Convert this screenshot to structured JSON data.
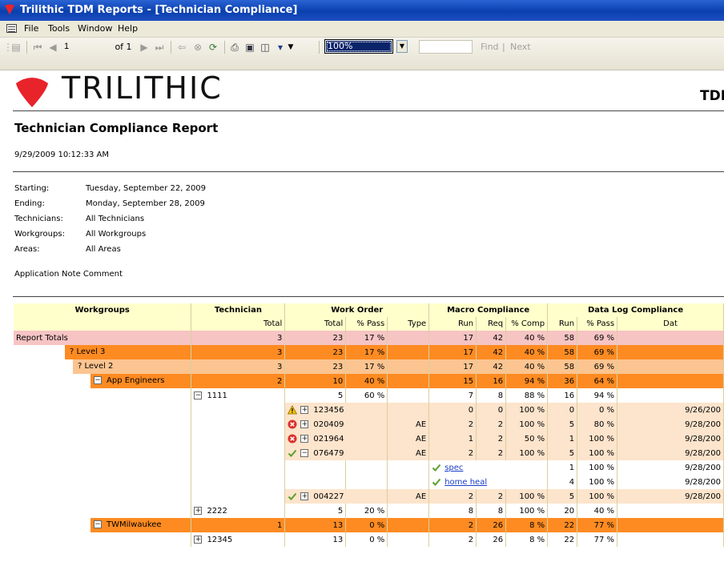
{
  "window": {
    "title": "Trilithic TDM Reports - [Technician Compliance]"
  },
  "menu": [
    "File",
    "Tools",
    "Window",
    "Help"
  ],
  "toolbar": {
    "page_input": "1",
    "page_of": "of 1",
    "zoom": "100%",
    "find_placeholder": "",
    "find_label": "Find",
    "find_sep": "|",
    "next_label": "Next"
  },
  "header": {
    "brand": "TRILITHIC",
    "product": "TDM"
  },
  "report": {
    "title": "Technician Compliance Report",
    "generated": "9/29/2009 10:12:33 AM",
    "params": [
      {
        "label": "Starting:",
        "value": "Tuesday, September 22, 2009"
      },
      {
        "label": "Ending:",
        "value": "Monday, September 28, 2009"
      },
      {
        "label": "Technicians:",
        "value": "All Technicians"
      },
      {
        "label": "Workgroups:",
        "value": "All Workgroups"
      },
      {
        "label": "Areas:",
        "value": "All Areas"
      }
    ],
    "comment": "Application Note Comment"
  },
  "table": {
    "group_headers": [
      "Workgroups",
      "Technician",
      "Work Order",
      "Macro Compliance",
      "Data Log Compliance"
    ],
    "sub_headers": [
      "Total",
      "Total",
      "% Pass",
      "Type",
      "Run",
      "Req",
      "% Comp",
      "Run",
      "% Pass",
      "Dat"
    ],
    "rows": [
      {
        "label": "Report Totals",
        "tech_total": "3",
        "wo_total": "23",
        "wo_pass": "17 %",
        "type": "",
        "m_run": "17",
        "m_req": "42",
        "m_comp": "40 %",
        "d_run": "58",
        "d_pass": "69 %",
        "date": ""
      },
      {
        "label": "? Level 3",
        "tech_total": "3",
        "wo_total": "23",
        "wo_pass": "17 %",
        "type": "",
        "m_run": "17",
        "m_req": "42",
        "m_comp": "40 %",
        "d_run": "58",
        "d_pass": "69 %",
        "date": ""
      },
      {
        "label": "? Level 2",
        "tech_total": "3",
        "wo_total": "23",
        "wo_pass": "17 %",
        "type": "",
        "m_run": "17",
        "m_req": "42",
        "m_comp": "40 %",
        "d_run": "58",
        "d_pass": "69 %",
        "date": ""
      },
      {
        "label": "App Engineers",
        "tech_total": "2",
        "wo_total": "10",
        "wo_pass": "40 %",
        "type": "",
        "m_run": "15",
        "m_req": "16",
        "m_comp": "94 %",
        "d_run": "36",
        "d_pass": "64 %",
        "date": ""
      },
      {
        "label": "1111",
        "wo_total": "5",
        "wo_pass": "60 %",
        "m_run": "7",
        "m_req": "8",
        "m_comp": "88 %",
        "d_run": "16",
        "d_pass": "94 %",
        "date": ""
      },
      {
        "label": "123456",
        "type": "",
        "m_run": "0",
        "m_req": "0",
        "m_comp": "100 %",
        "d_run": "0",
        "d_pass": "0 %",
        "date": "9/26/200"
      },
      {
        "label": "020409",
        "type": "AE",
        "m_run": "2",
        "m_req": "2",
        "m_comp": "100 %",
        "d_run": "5",
        "d_pass": "80 %",
        "date": "9/28/200"
      },
      {
        "label": "021964",
        "type": "AE",
        "m_run": "1",
        "m_req": "2",
        "m_comp": "50 %",
        "d_run": "1",
        "d_pass": "100 %",
        "date": "9/28/200"
      },
      {
        "label": "076479",
        "type": "AE",
        "m_run": "2",
        "m_req": "2",
        "m_comp": "100 %",
        "d_run": "5",
        "d_pass": "100 %",
        "date": "9/28/200"
      },
      {
        "label": "spec",
        "d_run": "1",
        "d_pass": "100 %",
        "date": "9/28/200"
      },
      {
        "label": "home heal",
        "d_run": "4",
        "d_pass": "100 %",
        "date": "9/28/200"
      },
      {
        "label": "004227",
        "type": "AE",
        "m_run": "2",
        "m_req": "2",
        "m_comp": "100 %",
        "d_run": "5",
        "d_pass": "100 %",
        "date": "9/28/200"
      },
      {
        "label": "2222",
        "wo_total": "5",
        "wo_pass": "20 %",
        "m_run": "8",
        "m_req": "8",
        "m_comp": "100 %",
        "d_run": "20",
        "d_pass": "40 %",
        "date": ""
      },
      {
        "label": "TWMilwaukee",
        "tech_total": "1",
        "wo_total": "13",
        "wo_pass": "0 %",
        "type": "",
        "m_run": "2",
        "m_req": "26",
        "m_comp": "8 %",
        "d_run": "22",
        "d_pass": "77 %",
        "date": ""
      },
      {
        "label": "12345",
        "wo_total": "13",
        "wo_pass": "0 %",
        "m_run": "2",
        "m_req": "26",
        "m_comp": "8 %",
        "d_run": "22",
        "d_pass": "77 %",
        "date": ""
      }
    ]
  },
  "colors": {
    "pink": "#f7c4c4",
    "orange": "#fd8b22",
    "peach": "#fcc490",
    "light_peach": "#fde4cc",
    "header": "#ffffcc",
    "titlebar": "#0a3fae"
  },
  "icons": [
    "warning-icon",
    "error-icon",
    "checkmark-icon",
    "expand-icon",
    "collapse-icon"
  ]
}
